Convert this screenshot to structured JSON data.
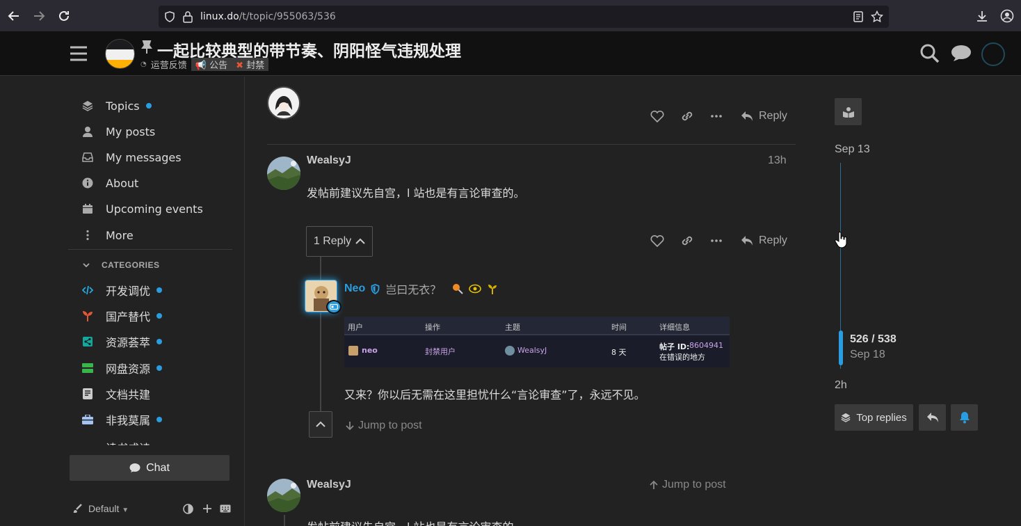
{
  "browser": {
    "url_host": "linux.do",
    "url_path": "/t/topic/955063/536"
  },
  "header": {
    "title": "一起比较典型的带节奏、阴阳怪气违规处理",
    "category": "运营反馈",
    "tags": [
      "公告",
      "封禁"
    ]
  },
  "sidebar": {
    "nav": [
      {
        "label": "Topics",
        "icon": "layers-icon",
        "dot": true
      },
      {
        "label": "My posts",
        "icon": "user-icon",
        "dot": false
      },
      {
        "label": "My messages",
        "icon": "inbox-icon",
        "dot": false
      },
      {
        "label": "About",
        "icon": "info-icon",
        "dot": false
      },
      {
        "label": "Upcoming events",
        "icon": "calendar-icon",
        "dot": false
      },
      {
        "label": "More",
        "icon": "vertical-ellipsis-icon",
        "dot": false
      }
    ],
    "categories_header": "CATEGORIES",
    "categories": [
      {
        "label": "开发调优",
        "color": "#25aae1",
        "dot": true
      },
      {
        "label": "国产替代",
        "color": "#e45735",
        "dot": true
      },
      {
        "label": "资源荟萃",
        "color": "#12a89d",
        "dot": true
      },
      {
        "label": "网盘资源",
        "color": "#3ab54a",
        "dot": true
      },
      {
        "label": "文档共建",
        "color": "#cccccc",
        "dot": false
      },
      {
        "label": "非我莫属",
        "color": "#a3c3f2",
        "dot": true
      },
      {
        "label": "读书成诗",
        "color": "#f1d20d",
        "dot": false
      }
    ],
    "chat_label": "Chat",
    "theme_label": "Default"
  },
  "posts": {
    "action_reply": "Reply",
    "post1": {
      "username": "WealsyJ",
      "time": "13h",
      "text": "发帖前建议先自宫，l 站也是有言论审查的。",
      "replies_label": "1 Reply"
    },
    "embedded_reply": {
      "username": "Neo",
      "user_title": "岂曰无衣？",
      "text": "又来？你以后无需在这里担忧什么“言论审查”了，永远不见。",
      "jump_label": "Jump to post",
      "table": {
        "headers": [
          "用户",
          "操作",
          "主题",
          "时间",
          "详细信息"
        ],
        "row": {
          "user": "neo",
          "action": "封禁用户",
          "subject": "WealsyJ",
          "duration": "8 天",
          "detail_label": "帖子 ID:",
          "detail_id": "8604941",
          "detail_note": "在错误的地方"
        }
      }
    },
    "post2": {
      "username": "WealsyJ",
      "jump_label": "Jump to post",
      "text": "发帖前建议先自宫，l 站也是有言论审查的。"
    }
  },
  "timeline": {
    "start_date": "Sep 13",
    "position": "526 / 538",
    "position_date": "Sep 18",
    "end_label": "2h",
    "top_replies_label": "Top replies",
    "progress": 0.978
  },
  "colors": {
    "accent": "#2a9de0",
    "header_bg": "#111111",
    "page_bg": "#222222"
  }
}
